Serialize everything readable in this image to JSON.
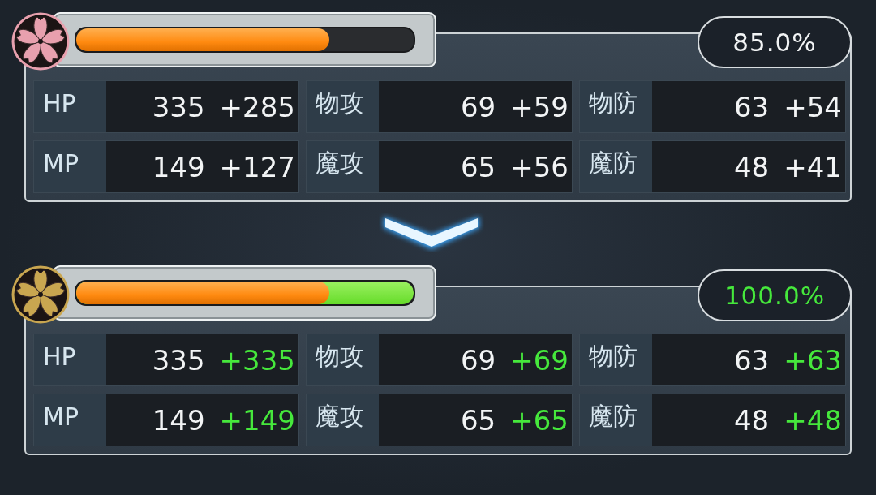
{
  "panels": [
    {
      "color": "#e8a0ae",
      "highlighted": false,
      "gauge": [
        {
          "kind": "base",
          "level": 0.75
        }
      ],
      "percent": "85.0%",
      "stats": [
        {
          "label": "HP",
          "value": "335",
          "bonus": "+285"
        },
        {
          "label": "物攻",
          "value": "69",
          "bonus": "+59"
        },
        {
          "label": "物防",
          "value": "63",
          "bonus": "+54"
        },
        {
          "label": "MP",
          "value": "149",
          "bonus": "+127"
        },
        {
          "label": "魔攻",
          "value": "65",
          "bonus": "+56"
        },
        {
          "label": "魔防",
          "value": "48",
          "bonus": "+41"
        }
      ]
    },
    {
      "color": "#c9a650",
      "highlighted": true,
      "gauge": [
        {
          "kind": "base",
          "level": 0.75
        },
        {
          "kind": "bonus",
          "level": 1.0
        }
      ],
      "percent": "100.0%",
      "stats": [
        {
          "label": "HP",
          "value": "335",
          "bonus": "+335"
        },
        {
          "label": "物攻",
          "value": "69",
          "bonus": "+69"
        },
        {
          "label": "物防",
          "value": "63",
          "bonus": "+63"
        },
        {
          "label": "MP",
          "value": "149",
          "bonus": "+149"
        },
        {
          "label": "魔攻",
          "value": "65",
          "bonus": "+65"
        },
        {
          "label": "魔防",
          "value": "48",
          "bonus": "+48"
        }
      ]
    }
  ]
}
